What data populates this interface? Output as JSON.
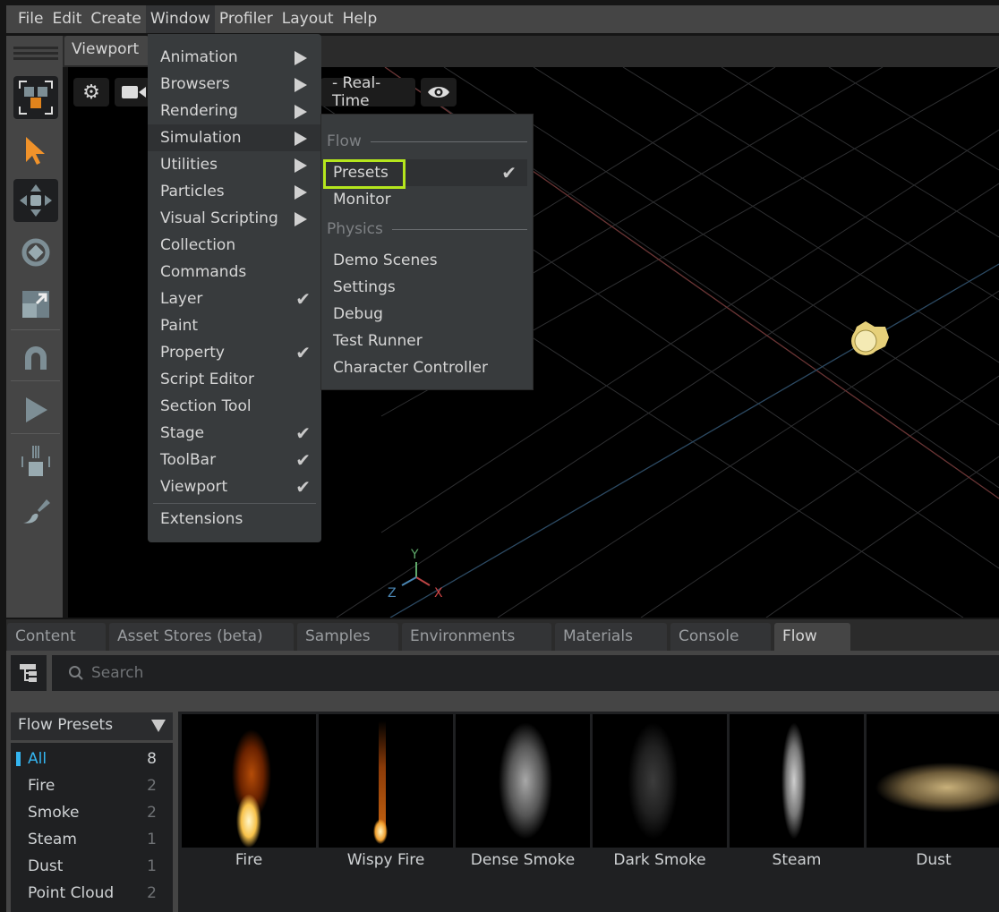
{
  "menubar": [
    "File",
    "Edit",
    "Create",
    "Window",
    "Profiler",
    "Layout",
    "Help"
  ],
  "viewport": {
    "tab": "Viewport",
    "render_mode": "- Real-Time"
  },
  "window_menu": {
    "items": [
      {
        "label": "Animation",
        "submenu": true
      },
      {
        "label": "Browsers",
        "submenu": true
      },
      {
        "label": "Rendering",
        "submenu": true
      },
      {
        "label": "Simulation",
        "submenu": true,
        "highlighted": true
      },
      {
        "label": "Utilities",
        "submenu": true
      },
      {
        "label": "Particles",
        "submenu": true
      },
      {
        "label": "Visual Scripting",
        "submenu": true
      },
      {
        "label": "Collection"
      },
      {
        "label": "Commands"
      },
      {
        "label": "Layer",
        "checked": true
      },
      {
        "label": "Paint"
      },
      {
        "label": "Property",
        "checked": true
      },
      {
        "label": "Script Editor"
      },
      {
        "label": "Section Tool"
      },
      {
        "label": "Stage",
        "checked": true
      },
      {
        "label": "ToolBar",
        "checked": true
      },
      {
        "label": "Viewport",
        "checked": true
      }
    ],
    "extensions": "Extensions"
  },
  "simulation_submenu": {
    "flow_header": "Flow",
    "flow_items": [
      {
        "label": "Presets",
        "checked": true,
        "focused": true
      },
      {
        "label": "Monitor"
      }
    ],
    "physics_header": "Physics",
    "physics_items": [
      "Demo Scenes",
      "Settings",
      "Debug",
      "Test Runner",
      "Character Controller"
    ]
  },
  "bottom_tabs": [
    "Content",
    "Asset Stores (beta)",
    "Samples",
    "Environments",
    "Materials",
    "Console",
    "Flow"
  ],
  "active_tab": "Flow",
  "search": {
    "placeholder": "Search"
  },
  "presets_dropdown": "Flow Presets",
  "categories": [
    {
      "label": "All",
      "count": "8"
    },
    {
      "label": "Fire",
      "count": "2"
    },
    {
      "label": "Smoke",
      "count": "2"
    },
    {
      "label": "Steam",
      "count": "1"
    },
    {
      "label": "Dust",
      "count": "1"
    },
    {
      "label": "Point Cloud",
      "count": "2"
    }
  ],
  "presets": [
    "Fire",
    "Wispy Fire",
    "Dense Smoke",
    "Dark Smoke",
    "Steam",
    "Dust"
  ],
  "gizmo": {
    "x": "X",
    "y": "Y",
    "z": "Z"
  },
  "colors": {
    "accent": "#34b5f0",
    "focus": "#b5e61d",
    "select_tool": "#f0922a"
  }
}
